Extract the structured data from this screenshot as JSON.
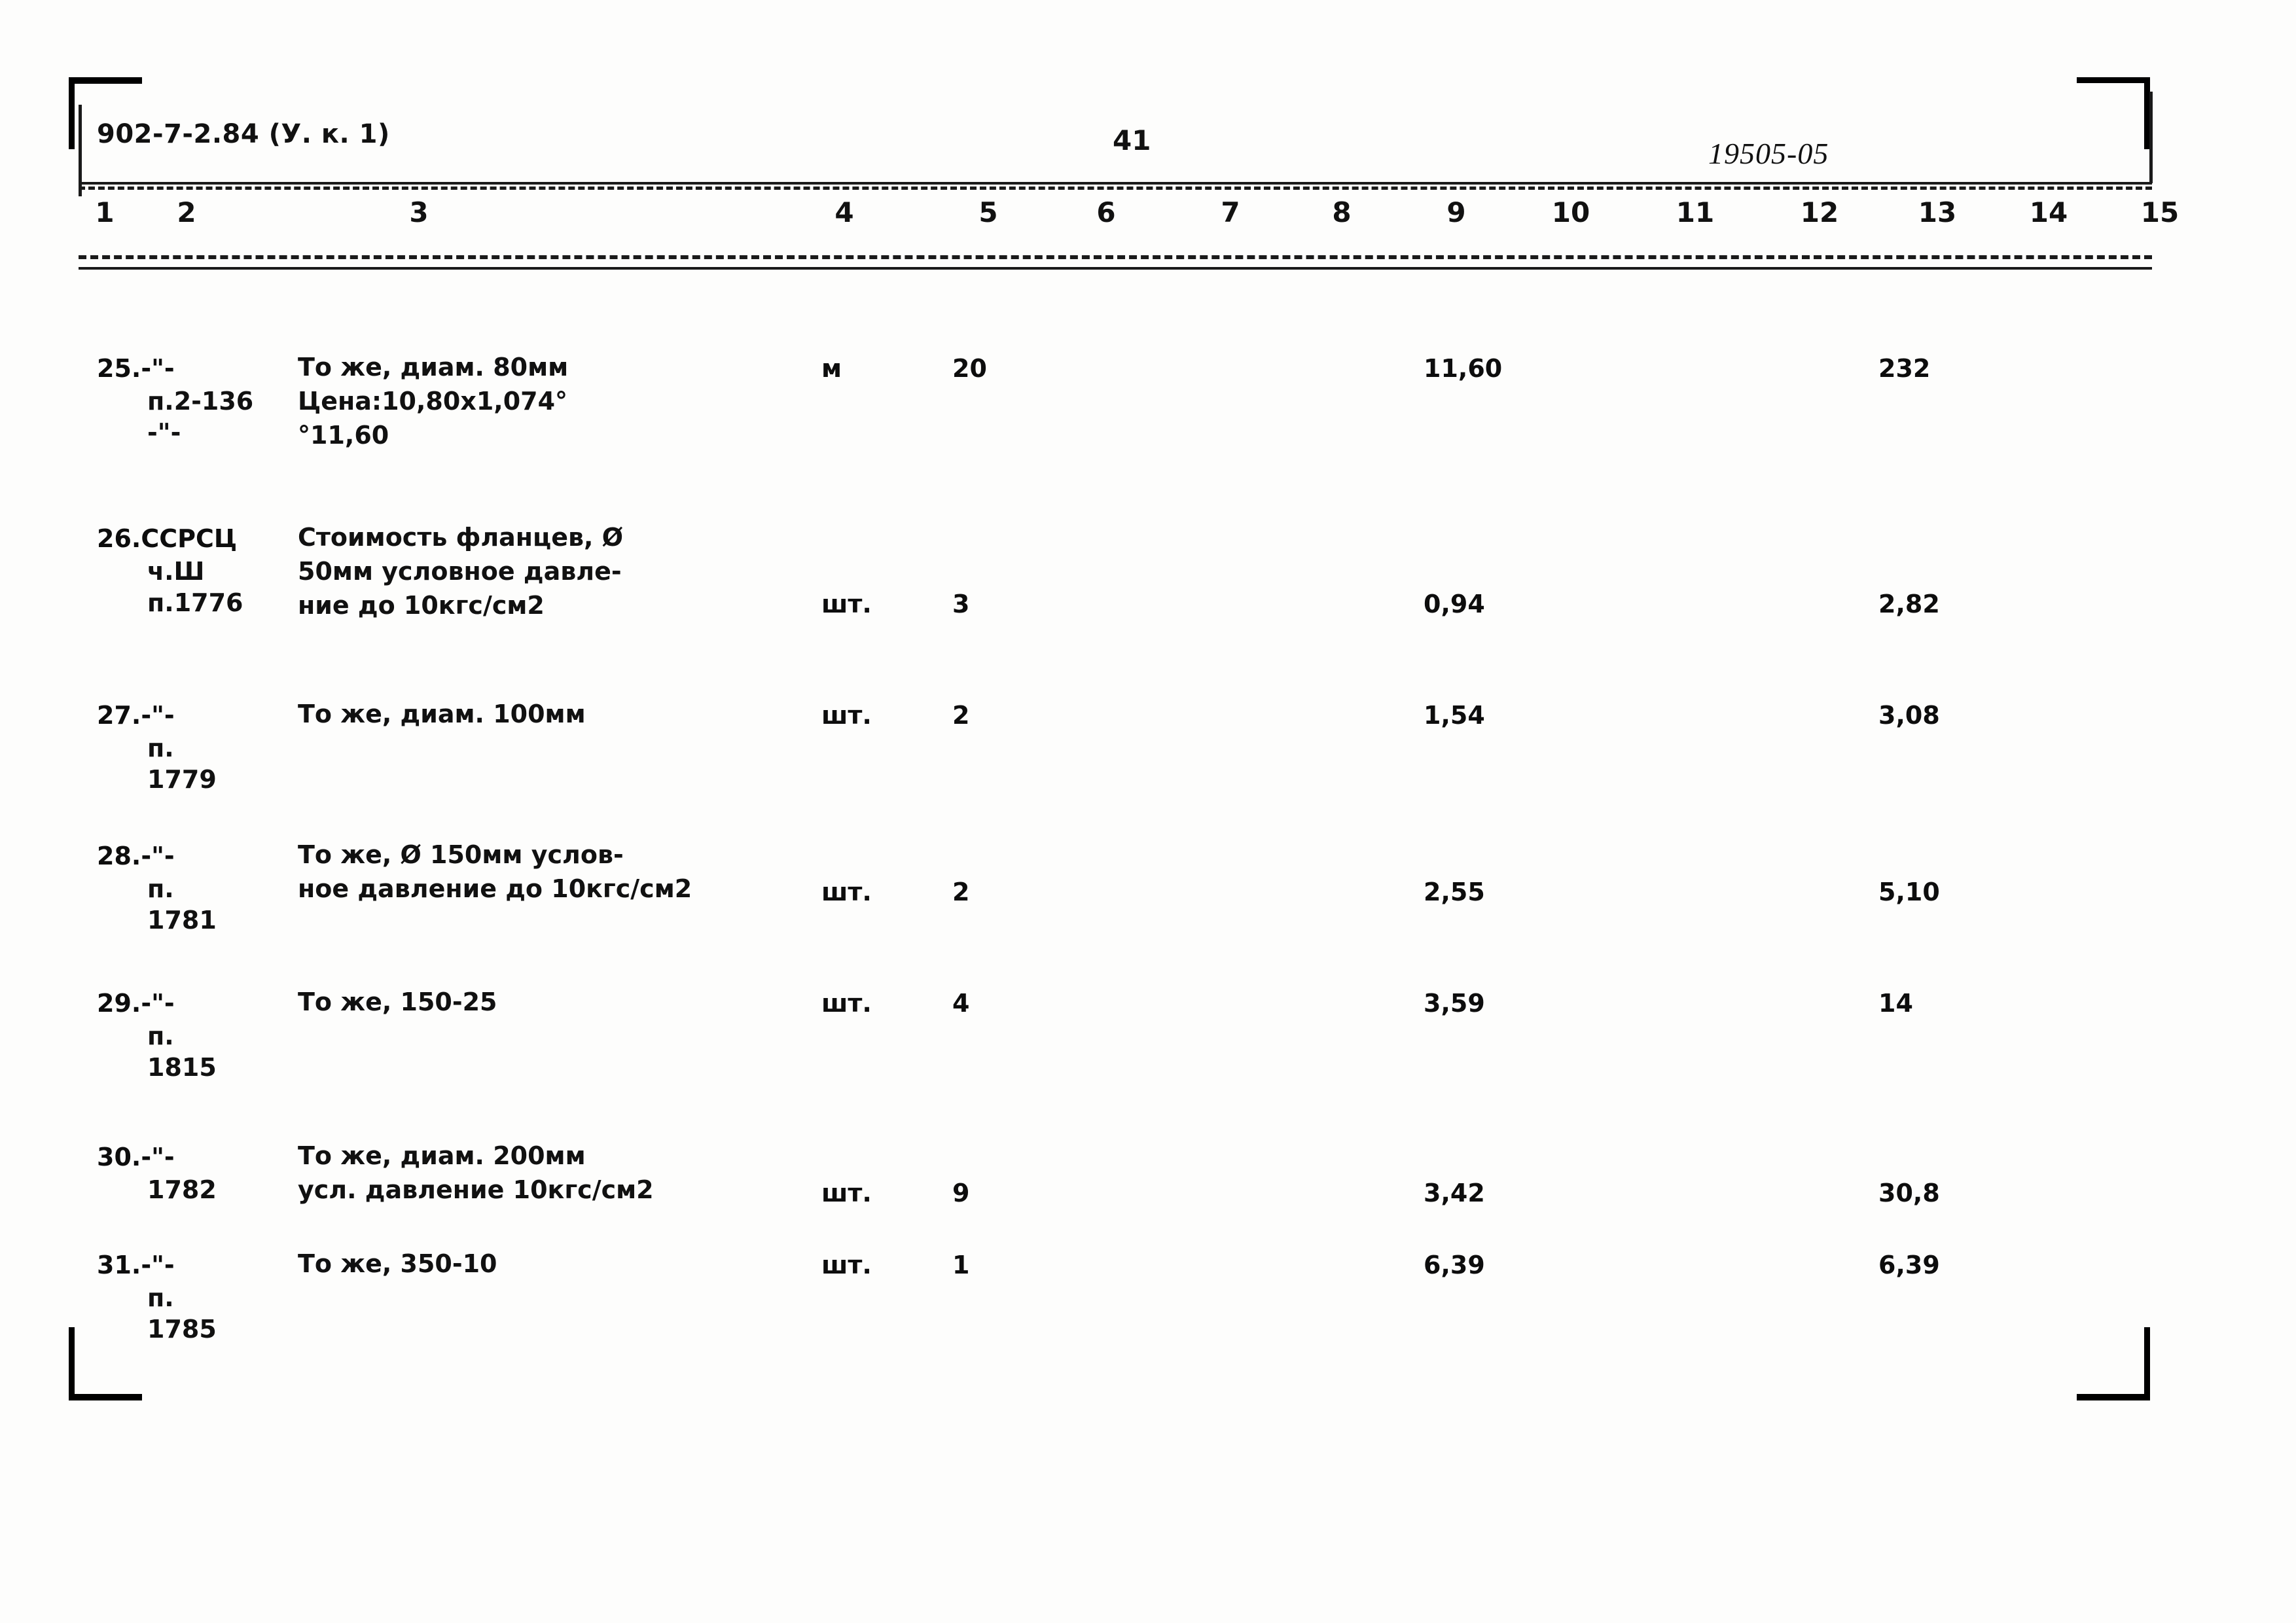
{
  "document": {
    "header_left": "902-7-2.84 (У. к. 1)",
    "page_number": "41",
    "header_right": "19505-05"
  },
  "table": {
    "column_numbers": [
      "1",
      "2",
      "3",
      "4",
      "5",
      "6",
      "7",
      "8",
      "9",
      "10",
      "11",
      "12",
      "13",
      "14",
      "15"
    ],
    "rows": [
      {
        "num": "25.-\"-",
        "ref_lines": [
          "п.2-136",
          "-\"-"
        ],
        "desc_lines": [
          "То же, диам. 80мм",
          "Цена:10,80х1,074°",
          "°11,60"
        ],
        "unit": "м",
        "qty": "20",
        "price": "11,60",
        "total": "232"
      },
      {
        "num": "26.ССРСЦ",
        "ref_lines": [
          "ч.Ш",
          "п.1776"
        ],
        "desc_lines": [
          "Стоимость фланцев, Ø",
          "50мм условное давле-",
          "ние до 10кгс/см2"
        ],
        "unit": "шт.",
        "qty": "3",
        "price": "0,94",
        "total": "2,82"
      },
      {
        "num": "27.-\"-",
        "ref_lines": [
          "п.",
          "1779"
        ],
        "desc_lines": [
          "То же, диам. 100мм"
        ],
        "unit": "шт.",
        "qty": "2",
        "price": "1,54",
        "total": "3,08"
      },
      {
        "num": "28.-\"-",
        "ref_lines": [
          "п.",
          "1781"
        ],
        "desc_lines": [
          "То же, Ø 150мм услов-",
          "ное давление до 10кгс/см2"
        ],
        "unit": "шт.",
        "qty": "2",
        "price": "2,55",
        "total": "5,10"
      },
      {
        "num": "29.-\"-",
        "ref_lines": [
          "п.",
          "1815"
        ],
        "desc_lines": [
          "То же, 150-25"
        ],
        "unit": "шт.",
        "qty": "4",
        "price": "3,59",
        "total": "14"
      },
      {
        "num": "30.-\"-",
        "ref_lines": [
          "1782"
        ],
        "desc_lines": [
          "То же, диам. 200мм",
          "усл. давление 10кгс/см2"
        ],
        "unit": "шт.",
        "qty": "9",
        "price": "3,42",
        "total": "30,8"
      },
      {
        "num": "31.-\"-",
        "ref_lines": [
          "п.",
          "1785"
        ],
        "desc_lines": [
          "То же, 350-10"
        ],
        "unit": "шт.",
        "qty": "1",
        "price": "6,39",
        "total": "6,39"
      }
    ]
  }
}
